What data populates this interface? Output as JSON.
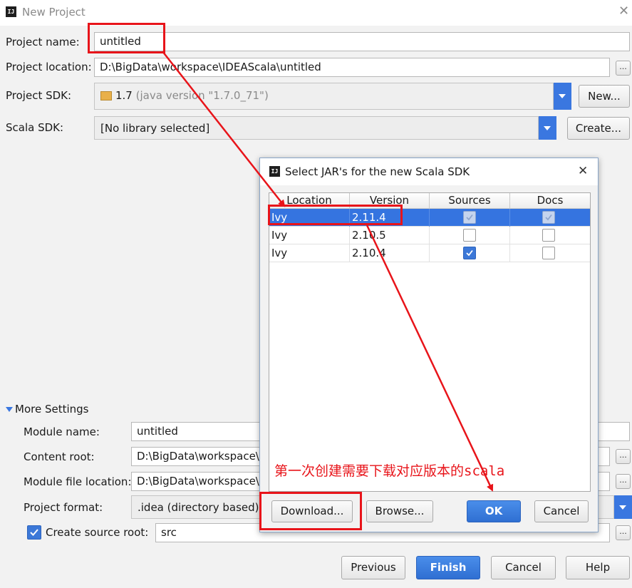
{
  "window": {
    "title": "New Project",
    "icon_text": "IJ",
    "close_glyph": "✕"
  },
  "form": {
    "project_name_label": "Project name:",
    "project_name_value": "untitled",
    "project_location_label": "Project location:",
    "project_location_value": "D:\\BigData\\workspace\\IDEAScala\\untitled",
    "project_sdk_label": "Project SDK:",
    "project_sdk_value": "1.7",
    "project_sdk_detail": "(java version \"1.7.0_71\")",
    "sdk_new_button": "New...",
    "scala_sdk_label": "Scala SDK:",
    "scala_sdk_value": "[No library selected]",
    "scala_create_button": "Create...",
    "ellipsis": "..."
  },
  "more_settings": {
    "header": "More Settings",
    "module_name_label": "Module name:",
    "module_name_value": "untitled",
    "content_root_label": "Content root:",
    "content_root_value": "D:\\BigData\\workspace\\IDEAScala\\untitled",
    "module_file_location_label": "Module file location:",
    "module_file_location_value": "D:\\BigData\\workspace\\IDEAScala\\untitled",
    "project_format_label": "Project format:",
    "project_format_value": ".idea (directory based)",
    "create_source_root_label": "Create source root:",
    "create_source_root_checked": true,
    "source_root_value": "src"
  },
  "footer": {
    "previous": "Previous",
    "finish": "Finish",
    "cancel": "Cancel",
    "help": "Help"
  },
  "dialog": {
    "title": "Select JAR's for the new Scala SDK",
    "close_glyph": "✕",
    "columns": [
      "Location",
      "Version",
      "Sources",
      "Docs"
    ],
    "rows": [
      {
        "location": "Ivy",
        "version": "2.11.4",
        "sources": true,
        "docs": true,
        "selected": true
      },
      {
        "location": "Ivy",
        "version": "2.10.5",
        "sources": false,
        "docs": false,
        "selected": false
      },
      {
        "location": "Ivy",
        "version": "2.10.4",
        "sources": true,
        "docs": false,
        "selected": false
      }
    ],
    "download_button": "Download...",
    "browse_button": "Browse...",
    "ok_button": "OK",
    "cancel_button": "Cancel"
  },
  "annotation": {
    "note": "第一次创建需要下载对应版本的scala",
    "color": "#e8141a"
  },
  "colors": {
    "accent": "#3574e0",
    "annotation_red": "#e8141a",
    "background": "#f2f2f2"
  }
}
